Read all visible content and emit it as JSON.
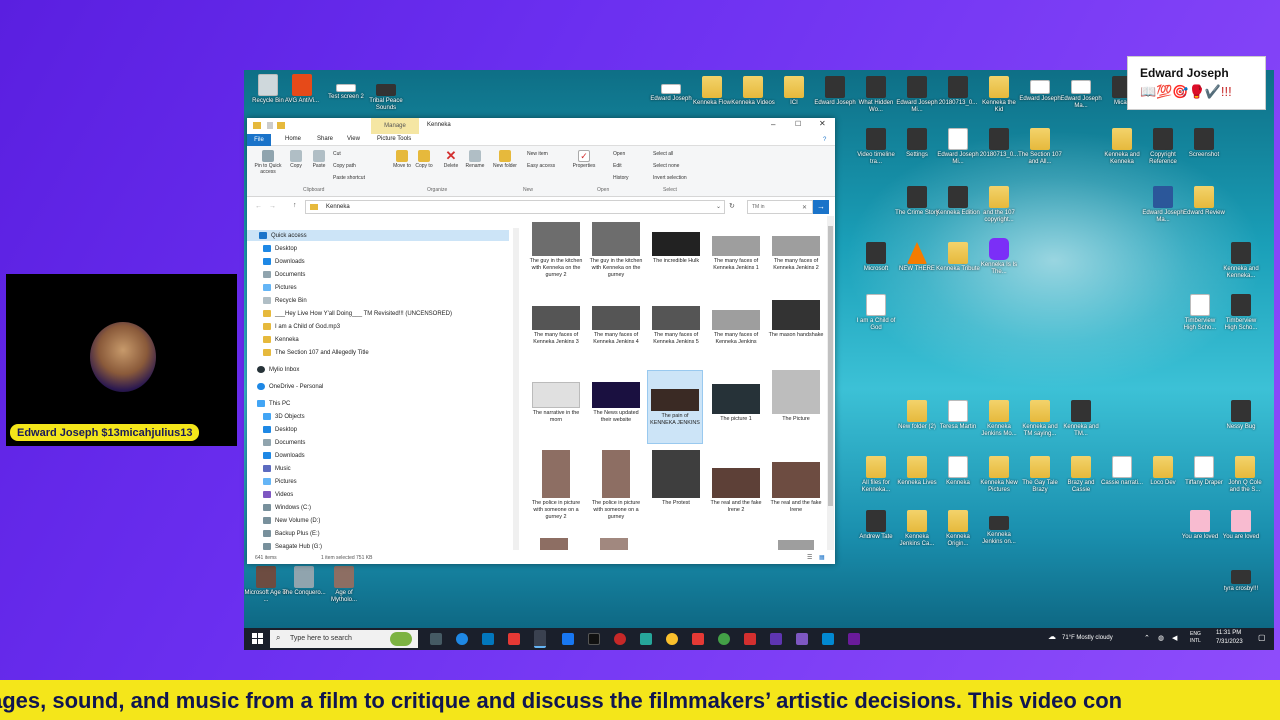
{
  "stream": {
    "name_card_title": "Edward Joseph",
    "name_card_emojis": "📖💯🎯🥊✔️!!!",
    "webcam_label": "Edward Joseph $13micahjulius13",
    "ticker_text": "ages, sound, and music from a film to critique and discuss the filmmakers’ artistic decisions. This video con"
  },
  "desktop": {
    "top_icons": [
      "Recycle Bin",
      "AVG AntiVi...",
      "Test screen 2",
      "Tribal Peace Sounds"
    ],
    "top_right_icons": [
      "Edward Joseph",
      "Kenneka Flow",
      "Kenneka Videos",
      "ICI",
      "Edward Joseph",
      "What Hidden Wo...",
      "Edward Joseph Mi...",
      "20180713_0...",
      "Kenneka the Kid",
      "Edward Joseph",
      "Edward Joseph Ma...",
      "Micah"
    ],
    "row2_icons": [
      "Video timeline tra...",
      "Settings",
      "Edward Joseph Mi...",
      "20180713_0...",
      "The Section 107 and All...",
      "Kenneka and Kenneka",
      "Copyright Reference",
      "Screenshot"
    ],
    "row3_icons": [
      "The Crime Story",
      "Kenneka Edition",
      "and the 107 copyright...",
      "Edward Joseph Ma...",
      "Edward Review"
    ],
    "row4_icons": [
      "Microsoft",
      "NEW THERE",
      "Kenneka Tribute",
      "Kenneka Is Is The..."
    ],
    "row5_icons": [
      "I am a Child of God",
      "Timberview High Scho...",
      "Timberview High Scho...",
      "Kenneka and Kenneka..."
    ],
    "row6_icons": [
      "New folder (2)",
      "Teresa Martin",
      "Kenneka Jenkins Mo...",
      "Kenneka and TM saying...",
      "Kenneka and TM...",
      "Nessy Bug"
    ],
    "row7_icons": [
      "All files for Kenneka...",
      "Kenneka Lives",
      "Kenneka",
      "Kenneka New Pictures",
      "The Gay Tale Brazy",
      "Brazy and Cassie",
      "Cassie narrati...",
      "Loco Dev",
      "Tiffany Draper",
      "John Q Cole and the S..."
    ],
    "row8_icons": [
      "Andrew Tate",
      "Kenneka Jenkins Ca...",
      "Kenneka Origin...",
      "Kenneka Jenkins on...",
      "You are loved",
      "You are loved"
    ],
    "bottom_left_icons": [
      "Microsoft Age of ...",
      "The Conquero...",
      "Age of Mytholo..."
    ],
    "other_icons": [
      "tyra crosby!!!"
    ]
  },
  "explorer": {
    "title": "Kenneka",
    "manage_tab": "Manage",
    "ribbon_tabs": [
      "File",
      "Home",
      "Share",
      "View",
      "Picture Tools"
    ],
    "clipboard": {
      "pin": "Pin to Quick access",
      "copy": "Copy",
      "paste": "Paste",
      "cut": "Cut",
      "copy_path": "Copy path",
      "paste_shortcut": "Paste shortcut",
      "label": "Clipboard"
    },
    "organize": {
      "move": "Move to",
      "copy": "Copy to",
      "delete": "Delete",
      "rename": "Rename",
      "label": "Organize"
    },
    "new_group": {
      "new_folder": "New folder",
      "new_item": "New item",
      "easy_access": "Easy access",
      "label": "New"
    },
    "open_group": {
      "properties": "Properties",
      "open": "Open",
      "edit": "Edit",
      "history": "History",
      "label": "Open"
    },
    "select_group": {
      "select_all": "Select all",
      "select_none": "Select none",
      "invert": "Invert selection",
      "label": "Select"
    },
    "address": "Kenneka",
    "search_placeholder": "TM in",
    "nav": [
      "Quick access",
      "Desktop",
      "Downloads",
      "Documents",
      "Pictures",
      "Recycle Bin",
      "___Hey Live How Y'all Doing___ TM Revisited!!! (UNCENSORED)",
      "I am a Child of God.mp3",
      "Kenneka",
      "The Section 107 and Allegedly Title",
      "Mylio Inbox",
      "OneDrive - Personal",
      "This PC",
      "3D Objects",
      "Desktop",
      "Documents",
      "Downloads",
      "Music",
      "Pictures",
      "Videos",
      "Windows (C:)",
      "New Volume (D:)",
      "Backup Plus (E:)",
      "Seagate Hub (G:)"
    ],
    "files": [
      "The guy in the kitchen with Kenneka on the gurney 2",
      "The guy in the kitchen with Kenneka on the gurney",
      "The incredible Hulk",
      "The many faces of Kenneka Jenkins 1",
      "The many faces of Kenneka Jenkins 2",
      "The many faces of Kenneka Jenkins 3",
      "The many faces of Kenneka Jenkins 4",
      "The many faces of Kenneka Jenkins 5",
      "The many faces of Kenneka Jenkins",
      "The mason handshake",
      "The narrative in the morn",
      "The News updated their website",
      "The pain of KENNEKA JENKINS",
      "The picture 1",
      "The Picture",
      "The police in picture with someone on a gurney 2",
      "The police in picture with someone on a gurney",
      "The Protest",
      "The real and the fake Irene 2",
      "The real and the fake Irene"
    ],
    "status": "641 items",
    "status_selected": "1 item selected  751 KB"
  },
  "taskbar": {
    "search_placeholder": "Type here to search",
    "weather": "71°F  Mostly cloudy",
    "lang": "ENG INTL",
    "time": "11:31 PM",
    "date": "7/31/2023"
  }
}
